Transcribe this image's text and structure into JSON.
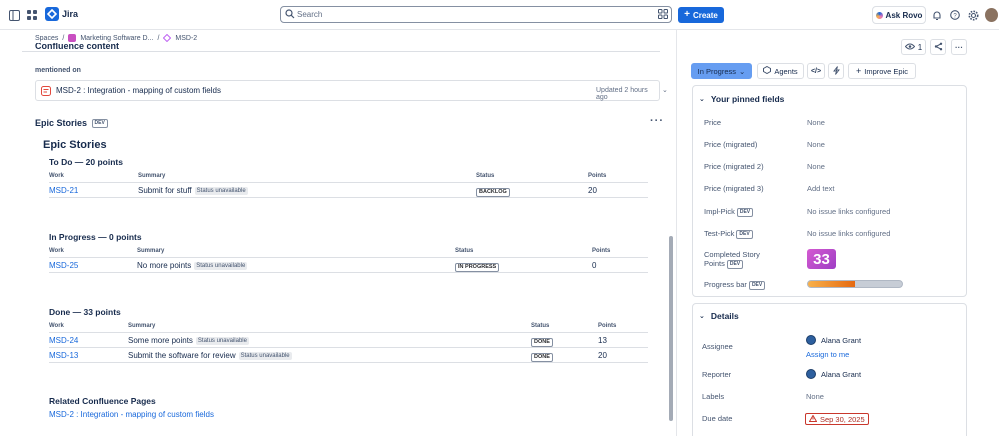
{
  "topbar": {
    "brand": "Jira",
    "search_placeholder": "Search",
    "create_label": "Create",
    "ask_rovo_label": "Ask Rovo"
  },
  "breadcrumb": {
    "spaces": "Spaces",
    "project": "Marketing Software D...",
    "issue": "MSD-2"
  },
  "main": {
    "cut_heading": "Confluence content",
    "mentioned_on": "mentioned on",
    "mention": {
      "title": "MSD-2 : Integration - mapping of custom fields",
      "updated": "Updated 2 hours ago"
    },
    "epic_stories_heading": "Epic Stories",
    "dev_badge": "DEV",
    "epic_stories_title": "Epic Stories",
    "groups": [
      {
        "title": "To Do — 20 points",
        "headers": [
          "Work",
          "Summary",
          "Status",
          "Points"
        ],
        "rows": [
          {
            "key": "MSD-21",
            "summary": "Submit for stuff",
            "unavail": "Status unavailable",
            "status": "BACKLOG",
            "points": "20"
          }
        ]
      },
      {
        "title": "In Progress — 0 points",
        "headers": [
          "Work",
          "Summary",
          "Status",
          "Points"
        ],
        "rows": [
          {
            "key": "MSD-25",
            "summary": "No more points",
            "unavail": "Status unavailable",
            "status": "IN PROGRESS",
            "points": "0"
          }
        ]
      },
      {
        "title": "Done — 33 points",
        "headers": [
          "Work",
          "Summary",
          "Status",
          "Points"
        ],
        "rows": [
          {
            "key": "MSD-24",
            "summary": "Some more points",
            "unavail": "Status unavailable",
            "status": "DONE",
            "points": "13"
          },
          {
            "key": "MSD-13",
            "summary": "Submit the software for review",
            "unavail": "Status unavailable",
            "status": "DONE",
            "points": "20"
          }
        ]
      }
    ],
    "related_title": "Related Confluence Pages",
    "related_link": "MSD-2 : Integration - mapping of custom fields"
  },
  "sidebar": {
    "watch_count": "1",
    "status_label": "In Progress",
    "agents_label": "Agents",
    "improve_label": "Improve Epic",
    "pinned_title": "Your pinned fields",
    "pinned": [
      {
        "label": "Price",
        "value": "None"
      },
      {
        "label": "Price (migrated)",
        "value": "None"
      },
      {
        "label": "Price (migrated 2)",
        "value": "None"
      },
      {
        "label": "Price (migrated 3)",
        "value": "Add text"
      },
      {
        "label": "Impl-Pick",
        "value": "No issue links configured"
      },
      {
        "label": "Test-Pick",
        "value": "No issue links configured"
      }
    ],
    "story_points_label_1": "Completed Story",
    "story_points_label_2": "Points",
    "story_points_value": "33",
    "progress_label": "Progress bar",
    "progress_fraction": 0.5,
    "details_title": "Details",
    "assignee_label": "Assignee",
    "assignee_name": "Alana Grant",
    "assign_to_me": "Assign to me",
    "reporter_label": "Reporter",
    "reporter_name": "Alana Grant",
    "labels_label": "Labels",
    "labels_value": "None",
    "due_label": "Due date",
    "due_value": "Sep 30, 2025"
  },
  "colors": {
    "accent": "#1868db",
    "status_in_progress": "#669df1",
    "danger": "#c9372c"
  }
}
